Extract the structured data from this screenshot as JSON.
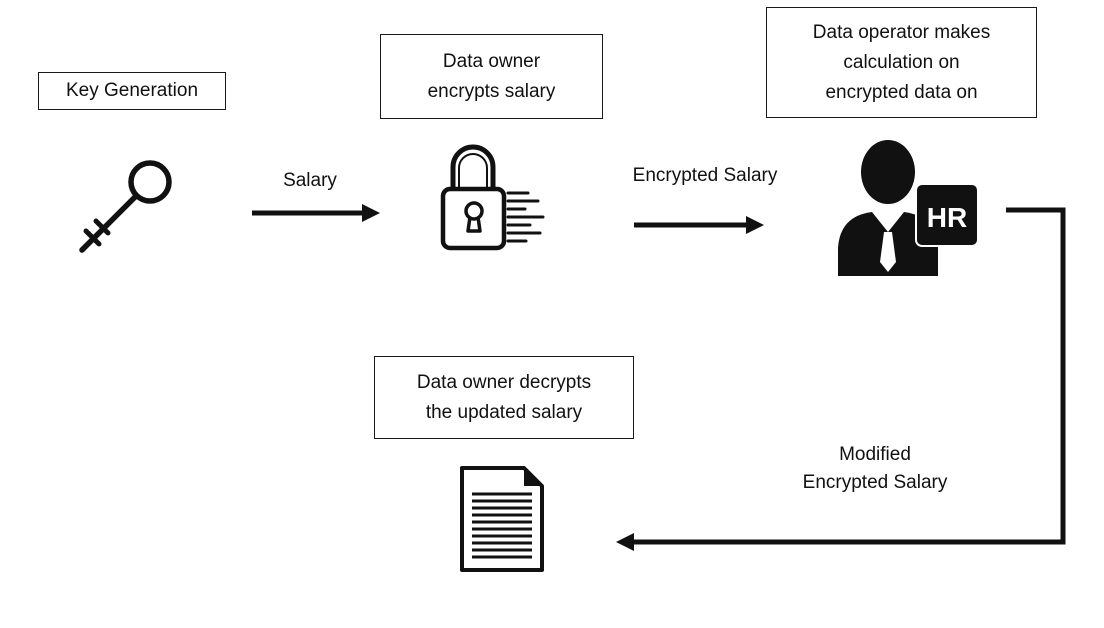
{
  "steps": {
    "key_generation": {
      "lines": [
        "Key Generation"
      ]
    },
    "encrypt": {
      "lines": [
        "Data owner",
        "encrypts salary"
      ]
    },
    "operator": {
      "lines": [
        "Data operator makes",
        "calculation on",
        "encrypted data on"
      ]
    },
    "decrypt": {
      "lines": [
        "Data owner decrypts",
        "the updated salary"
      ]
    }
  },
  "arrows": {
    "salary": {
      "label": "Salary"
    },
    "encrypted_salary": {
      "label": "Encrypted Salary"
    },
    "modified": {
      "lines": [
        "Modified",
        "Encrypted Salary"
      ]
    }
  },
  "icons": {
    "key": "key-icon",
    "lock": "padlock-data-icon",
    "operator": "hr-person-icon",
    "operator_badge": "HR",
    "document": "document-icon"
  },
  "colors": {
    "ink": "#111111",
    "background": "#ffffff"
  }
}
